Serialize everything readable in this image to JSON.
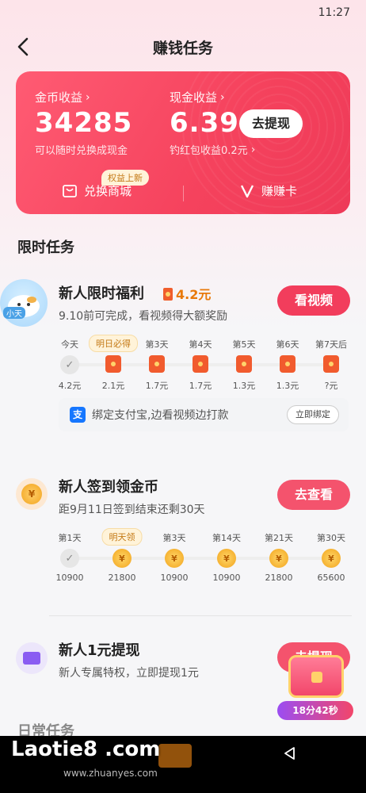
{
  "status": {
    "time": "11:27"
  },
  "nav": {
    "title": "赚钱任务"
  },
  "earn_card": {
    "coin_label": "金币收益",
    "coin_value": "34285",
    "coin_sub": "可以随时兑换成现金",
    "cash_label": "现金收益",
    "cash_value": "6.39",
    "withdraw_btn": "去提现",
    "cash_sub": "钓红包收益0.2元",
    "shop_label": "兑换商城",
    "shop_badge": "权益上新",
    "earncard_label": "赚赚卡"
  },
  "section": {
    "title": "限时任务"
  },
  "task_newbie_welfare": {
    "avatar_tag": "小天",
    "title": "新人限时福利",
    "reward": "4.2元",
    "subtitle": "9.10前可完成，看视频得大额奖励",
    "button": "看视频",
    "tip": "明日必得",
    "days": [
      {
        "label": "今天",
        "value": "4.2元",
        "state": "done"
      },
      {
        "label": "",
        "value": "2.1元",
        "state": "envelope"
      },
      {
        "label": "第3天",
        "value": "1.7元",
        "state": "envelope"
      },
      {
        "label": "第4天",
        "value": "1.7元",
        "state": "envelope"
      },
      {
        "label": "第5天",
        "value": "1.3元",
        "state": "envelope"
      },
      {
        "label": "第6天",
        "value": "1.3元",
        "state": "envelope"
      },
      {
        "label": "第7天后",
        "value": "?元",
        "state": "envelope"
      }
    ],
    "alipay_text": "绑定支付宝,边看视频边打款",
    "bind_btn": "立即绑定"
  },
  "task_checkin": {
    "title": "新人签到领金币",
    "subtitle": "距9月11日签到结束还剩30天",
    "button": "去查看",
    "tip": "明天领",
    "days": [
      {
        "label": "第1天",
        "value": "10900",
        "state": "done"
      },
      {
        "label": "",
        "value": "21800",
        "state": "coin"
      },
      {
        "label": "第3天",
        "value": "10900",
        "state": "coin"
      },
      {
        "label": "第14天",
        "value": "10900",
        "state": "coin"
      },
      {
        "label": "第21天",
        "value": "21800",
        "state": "coin"
      },
      {
        "label": "第30天",
        "value": "65600",
        "state": "coin-stack"
      }
    ]
  },
  "task_withdraw": {
    "title": "新人1元提现",
    "subtitle": "新人专属特权，立即提现1元",
    "button": "去提现"
  },
  "chest": {
    "timer": "18分42秒"
  },
  "daily": {
    "title": "日常任务"
  },
  "watermark": {
    "logo": "Laotie8 .com",
    "url": "www.zhuanyes.com"
  }
}
